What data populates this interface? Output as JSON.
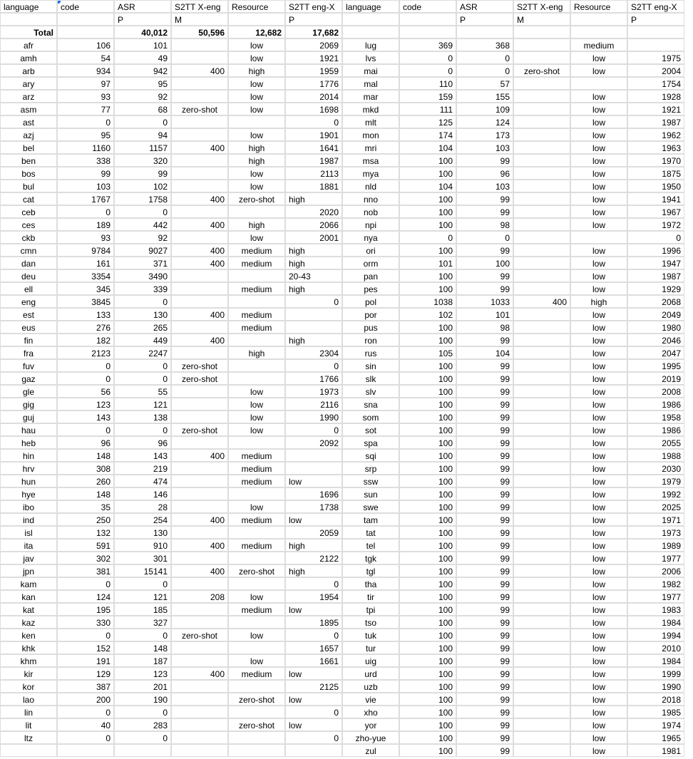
{
  "headers": [
    "language",
    "code",
    "ASR",
    "S2TT X-eng",
    "Resource",
    "S2TT eng-X",
    "language",
    "code",
    "ASR",
    "S2TT X-eng",
    "Resource",
    "S2TT eng-X"
  ],
  "subheaders": [
    "",
    "",
    "P",
    "M",
    "",
    "P",
    "",
    "",
    "P",
    "M",
    "",
    "P"
  ],
  "totalRow": [
    "Total",
    "",
    "40,012",
    "50,596",
    "12,682",
    "17,682",
    "",
    "",
    "",
    "",
    "",
    ""
  ],
  "rows": [
    [
      "afr",
      "106",
      "101",
      "",
      "low",
      "2069",
      "lug",
      "369",
      "368",
      "",
      "medium",
      ""
    ],
    [
      "amh",
      "54",
      "49",
      "",
      "low",
      "1921",
      "lvs",
      "0",
      "0",
      "",
      "low",
      "1975"
    ],
    [
      "arb",
      "934",
      "942",
      "400",
      "high",
      "1959",
      "mai",
      "0",
      "0",
      "zero-shot",
      "low",
      "2004"
    ],
    [
      "ary",
      "97",
      "95",
      "",
      "low",
      "1776",
      "mal",
      "110",
      "57",
      "",
      "",
      "1754"
    ],
    [
      "arz",
      "93",
      "92",
      "",
      "low",
      "2014",
      "mar",
      "159",
      "155",
      "",
      "low",
      "1928"
    ],
    [
      "asm",
      "77",
      "68",
      "zero-shot",
      "low",
      "1698",
      "mkd",
      "111",
      "109",
      "",
      "low",
      "1921"
    ],
    [
      "ast",
      "0",
      "0",
      "",
      "",
      "0",
      "mlt",
      "125",
      "124",
      "",
      "low",
      "1987"
    ],
    [
      "azj",
      "95",
      "94",
      "",
      "low",
      "1901",
      "mon",
      "174",
      "173",
      "",
      "low",
      "1962"
    ],
    [
      "bel",
      "1160",
      "1157",
      "400",
      "high",
      "1641",
      "mri",
      "104",
      "103",
      "",
      "low",
      "1963"
    ],
    [
      "ben",
      "338",
      "320",
      "",
      "high",
      "1987",
      "msa",
      "100",
      "99",
      "",
      "low",
      "1970"
    ],
    [
      "bos",
      "99",
      "99",
      "",
      "low",
      "2113",
      "mya",
      "100",
      "96",
      "",
      "low",
      "1875"
    ],
    [
      "bul",
      "103",
      "102",
      "",
      "low",
      "1881",
      "nld",
      "104",
      "103",
      "",
      "low",
      "1950"
    ],
    [
      "cat",
      "1767",
      "1758",
      "400",
      "zero-shot",
      "high",
      "nno",
      "100",
      "99",
      "",
      "low",
      "1941"
    ],
    [
      "ceb",
      "0",
      "0",
      "",
      "",
      "2020",
      "nob",
      "100",
      "99",
      "",
      "low",
      "1967"
    ],
    [
      "ces",
      "189",
      "442",
      "400",
      "high",
      "2066",
      "npi",
      "100",
      "98",
      "",
      "low",
      "1972"
    ],
    [
      "ckb",
      "93",
      "92",
      "",
      "low",
      "2001",
      "nya",
      "0",
      "0",
      "",
      "",
      "0"
    ],
    [
      "cmn",
      "9784",
      "9027",
      "400",
      "medium",
      "high",
      "ori",
      "100",
      "99",
      "",
      "low",
      "1996"
    ],
    [
      "dan",
      "161",
      "371",
      "400",
      "medium",
      "high",
      "orm",
      "101",
      "100",
      "",
      "low",
      "1947"
    ],
    [
      "deu",
      "3354",
      "3490",
      "",
      "",
      "20-43",
      "pan",
      "100",
      "99",
      "",
      "low",
      "1987"
    ],
    [
      "ell",
      "345",
      "339",
      "",
      "medium",
      "high",
      "pes",
      "100",
      "99",
      "",
      "low",
      "1929"
    ],
    [
      "eng",
      "3845",
      "0",
      "",
      "",
      "0",
      "pol",
      "1038",
      "1033",
      "400",
      "high",
      "2068"
    ],
    [
      "est",
      "133",
      "130",
      "400",
      "medium",
      "",
      "por",
      "102",
      "101",
      "",
      "low",
      "2049"
    ],
    [
      "eus",
      "276",
      "265",
      "",
      "medium",
      "",
      "pus",
      "100",
      "98",
      "",
      "low",
      "1980"
    ],
    [
      "fin",
      "182",
      "449",
      "400",
      "",
      "high",
      "ron",
      "100",
      "99",
      "",
      "low",
      "2046"
    ],
    [
      "fra",
      "2123",
      "2247",
      "",
      "high",
      "2304",
      "rus",
      "105",
      "104",
      "",
      "low",
      "2047"
    ],
    [
      "fuv",
      "0",
      "0",
      "zero-shot",
      "",
      "0",
      "sin",
      "100",
      "99",
      "",
      "low",
      "1995"
    ],
    [
      "gaz",
      "0",
      "0",
      "zero-shot",
      "",
      "1766",
      "slk",
      "100",
      "99",
      "",
      "low",
      "2019"
    ],
    [
      "gle",
      "56",
      "55",
      "",
      "low",
      "1973",
      "slv",
      "100",
      "99",
      "",
      "low",
      "2008"
    ],
    [
      "gig",
      "123",
      "121",
      "",
      "low",
      "2116",
      "sna",
      "100",
      "99",
      "",
      "low",
      "1986"
    ],
    [
      "guj",
      "143",
      "138",
      "",
      "low",
      "1990",
      "som",
      "100",
      "99",
      "",
      "low",
      "1958"
    ],
    [
      "hau",
      "0",
      "0",
      "zero-shot",
      "low",
      "0",
      "sot",
      "100",
      "99",
      "",
      "low",
      "1986"
    ],
    [
      "heb",
      "96",
      "96",
      "",
      "",
      "2092",
      "spa",
      "100",
      "99",
      "",
      "low",
      "2055"
    ],
    [
      "hin",
      "148",
      "143",
      "400",
      "medium",
      "",
      "sqi",
      "100",
      "99",
      "",
      "low",
      "1988"
    ],
    [
      "hrv",
      "308",
      "219",
      "",
      "medium",
      "",
      "srp",
      "100",
      "99",
      "",
      "low",
      "2030"
    ],
    [
      "hun",
      "260",
      "474",
      "",
      "medium",
      "low",
      "ssw",
      "100",
      "99",
      "",
      "low",
      "1979"
    ],
    [
      "hye",
      "148",
      "146",
      "",
      "",
      "1696",
      "sun",
      "100",
      "99",
      "",
      "low",
      "1992"
    ],
    [
      "ibo",
      "35",
      "28",
      "",
      "low",
      "1738",
      "swe",
      "100",
      "99",
      "",
      "low",
      "2025"
    ],
    [
      "ind",
      "250",
      "254",
      "400",
      "medium",
      "low",
      "tam",
      "100",
      "99",
      "",
      "low",
      "1971"
    ],
    [
      "isl",
      "132",
      "130",
      "",
      "",
      "2059",
      "tat",
      "100",
      "99",
      "",
      "low",
      "1973"
    ],
    [
      "ita",
      "591",
      "910",
      "400",
      "medium",
      "high",
      "tel",
      "100",
      "99",
      "",
      "low",
      "1989"
    ],
    [
      "jav",
      "302",
      "301",
      "",
      "",
      "2122",
      "tgk",
      "100",
      "99",
      "",
      "low",
      "1977"
    ],
    [
      "jpn",
      "381",
      "15141",
      "400",
      "zero-shot",
      "high",
      "tgl",
      "100",
      "99",
      "",
      "low",
      "2006"
    ],
    [
      "kam",
      "0",
      "0",
      "",
      "",
      "0",
      "tha",
      "100",
      "99",
      "",
      "low",
      "1982"
    ],
    [
      "kan",
      "124",
      "121",
      "208",
      "low",
      "1954",
      "tir",
      "100",
      "99",
      "",
      "low",
      "1977"
    ],
    [
      "kat",
      "195",
      "185",
      "",
      "medium",
      "low",
      "tpi",
      "100",
      "99",
      "",
      "low",
      "1983"
    ],
    [
      "kaz",
      "330",
      "327",
      "",
      "",
      "1895",
      "tso",
      "100",
      "99",
      "",
      "low",
      "1984"
    ],
    [
      "ken",
      "0",
      "0",
      "zero-shot",
      "low",
      "0",
      "tuk",
      "100",
      "99",
      "",
      "low",
      "1994"
    ],
    [
      "khk",
      "152",
      "148",
      "",
      "",
      "1657",
      "tur",
      "100",
      "99",
      "",
      "low",
      "2010"
    ],
    [
      "khm",
      "191",
      "187",
      "",
      "low",
      "1661",
      "uig",
      "100",
      "99",
      "",
      "low",
      "1984"
    ],
    [
      "kir",
      "129",
      "123",
      "400",
      "medium",
      "low",
      "urd",
      "100",
      "99",
      "",
      "low",
      "1999"
    ],
    [
      "kor",
      "387",
      "201",
      "",
      "",
      "2125",
      "uzb",
      "100",
      "99",
      "",
      "low",
      "1990"
    ],
    [
      "lao",
      "200",
      "190",
      "",
      "zero-shot",
      "low",
      "vie",
      "100",
      "99",
      "",
      "low",
      "2018"
    ],
    [
      "lin",
      "0",
      "0",
      "",
      "",
      "0",
      "xho",
      "100",
      "99",
      "",
      "low",
      "1985"
    ],
    [
      "lit",
      "40",
      "283",
      "",
      "zero-shot",
      "low",
      "yor",
      "100",
      "99",
      "",
      "low",
      "1974"
    ],
    [
      "ltz",
      "0",
      "0",
      "",
      "",
      "0",
      "zho-yue",
      "100",
      "99",
      "",
      "low",
      "1965"
    ],
    [
      "",
      "",
      "",
      "",
      "",
      "",
      "zul",
      "100",
      "99",
      "",
      "low",
      "1981"
    ]
  ]
}
